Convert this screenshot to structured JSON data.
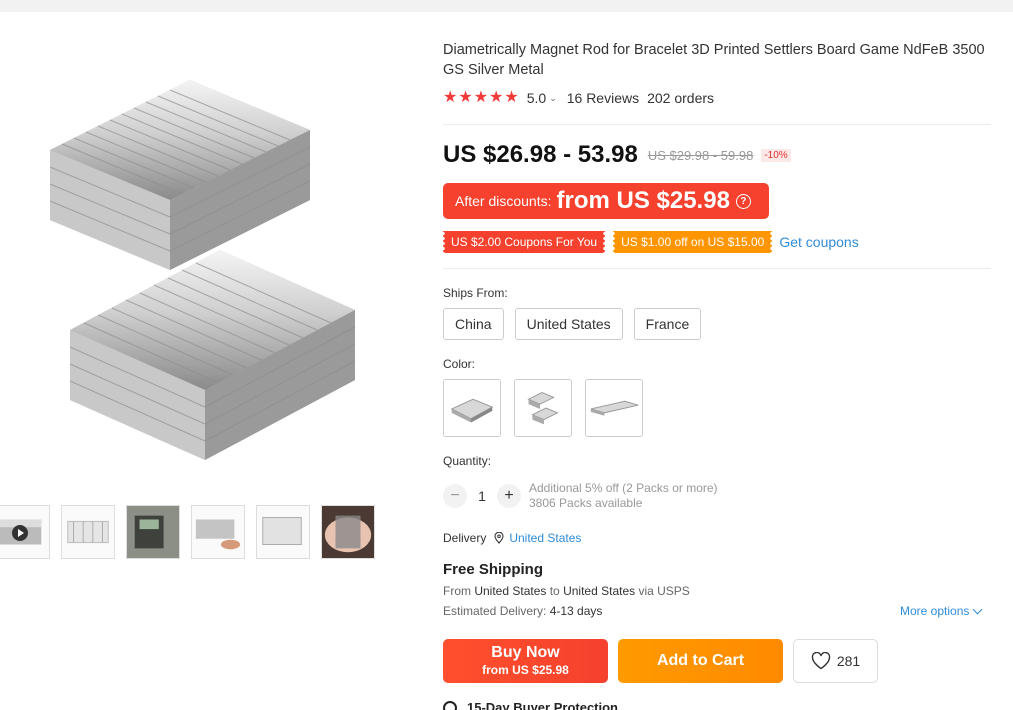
{
  "product": {
    "title": "Diametrically Magnet Rod for Bracelet 3D Printed Settlers Board Game NdFeB 3500 GS Silver Metal",
    "rating": "5.0",
    "reviews": "16 Reviews",
    "orders": "202 orders",
    "star_color": "#f33a3a"
  },
  "price": {
    "range": "US $26.98 - 53.98",
    "original": "US $29.98 - 59.98",
    "discount": "-10%",
    "after_label": "After discounts:",
    "after_price": "from US $25.98",
    "accent": "#f5412d"
  },
  "coupons": {
    "items": [
      "US $2.00 Coupons For You",
      "US $1.00 off on US $15.00"
    ],
    "get_label": "Get coupons"
  },
  "ships_from": {
    "label": "Ships From:",
    "options": [
      "China",
      "United States",
      "France"
    ]
  },
  "color": {
    "label": "Color:"
  },
  "quantity": {
    "label": "Quantity:",
    "minus": "−",
    "value": "1",
    "plus": "+",
    "note1": "Additional 5% off (2 Packs or more)",
    "note2": "3806 Packs available"
  },
  "delivery": {
    "label": "Delivery",
    "country": "United States"
  },
  "shipping": {
    "title": "Free Shipping",
    "from_prefix": "From ",
    "from": "United States",
    "to_prefix": " to ",
    "to": "United States",
    "via": " via USPS",
    "est_label": "Estimated Delivery: ",
    "est_value": "4-13 days",
    "more": "More options"
  },
  "actions": {
    "buy_now": "Buy Now",
    "buy_now_sub": "from US $25.98",
    "add_cart": "Add to Cart",
    "wish_count": "281",
    "protection": "15-Day Buyer Protection"
  },
  "icons": {
    "star": "star-icon",
    "pin": "location-pin-icon",
    "heart": "heart-icon",
    "help": "question-icon",
    "play": "play-icon"
  }
}
